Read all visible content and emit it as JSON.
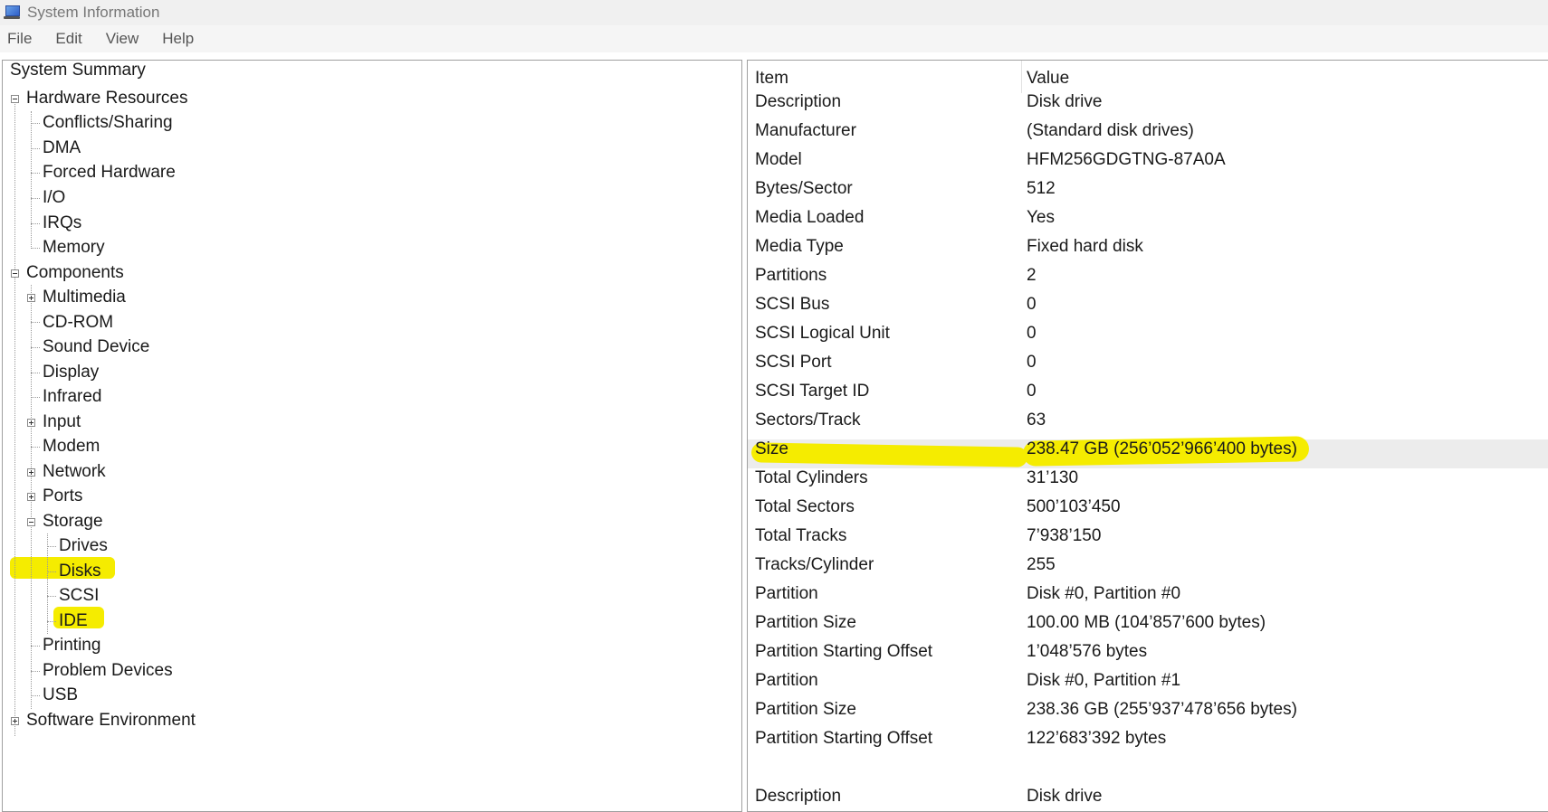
{
  "window": {
    "title": "System Information",
    "icon": "system-information-icon"
  },
  "menu": [
    "File",
    "Edit",
    "View",
    "Help"
  ],
  "tree": {
    "root": "System Summary",
    "hardware_resources": {
      "label": "Hardware Resources",
      "children": [
        "Conflicts/Sharing",
        "DMA",
        "Forced Hardware",
        "I/O",
        "IRQs",
        "Memory"
      ]
    },
    "components": {
      "label": "Components",
      "multimedia": "Multimedia",
      "cdrom": "CD-ROM",
      "sound_device": "Sound Device",
      "display": "Display",
      "infrared": "Infrared",
      "input": "Input",
      "modem": "Modem",
      "network": "Network",
      "ports": "Ports",
      "storage": {
        "label": "Storage",
        "children": [
          "Drives",
          "Disks",
          "SCSI",
          "IDE"
        ]
      },
      "printing": "Printing",
      "problem_devices": "Problem Devices",
      "usb": "USB"
    },
    "software_environment": "Software Environment",
    "selected": "Disks",
    "highlight_color": "#f5ec00"
  },
  "table": {
    "columns": [
      "Item",
      "Value"
    ],
    "rows": [
      {
        "item": "Description",
        "value": "Disk drive"
      },
      {
        "item": "Manufacturer",
        "value": "(Standard disk drives)"
      },
      {
        "item": "Model",
        "value": "HFM256GDGTNG-87A0A"
      },
      {
        "item": "Bytes/Sector",
        "value": "512"
      },
      {
        "item": "Media Loaded",
        "value": "Yes"
      },
      {
        "item": "Media Type",
        "value": "Fixed hard disk"
      },
      {
        "item": "Partitions",
        "value": "2"
      },
      {
        "item": "SCSI Bus",
        "value": "0"
      },
      {
        "item": "SCSI Logical Unit",
        "value": "0"
      },
      {
        "item": "SCSI Port",
        "value": "0"
      },
      {
        "item": "SCSI Target ID",
        "value": "0"
      },
      {
        "item": "Sectors/Track",
        "value": "63"
      },
      {
        "item": "Size",
        "value": "238.47 GB (256’052’966’400 bytes)"
      },
      {
        "item": "Total Cylinders",
        "value": "31’130"
      },
      {
        "item": "Total Sectors",
        "value": "500’103’450"
      },
      {
        "item": "Total Tracks",
        "value": "7’938’150"
      },
      {
        "item": "Tracks/Cylinder",
        "value": "255"
      },
      {
        "item": "Partition",
        "value": "Disk #0, Partition #0"
      },
      {
        "item": "Partition Size",
        "value": "100.00 MB (104’857’600 bytes)"
      },
      {
        "item": "Partition Starting Offset",
        "value": "1’048’576 bytes"
      },
      {
        "item": "Partition",
        "value": "Disk #0, Partition #1"
      },
      {
        "item": "Partition Size",
        "value": "238.36 GB (255’937’478’656 bytes)"
      },
      {
        "item": "Partition Starting Offset",
        "value": "122’683’392 bytes"
      },
      {
        "item": "Description",
        "value": "Disk drive"
      }
    ],
    "selected_row": "Size"
  }
}
